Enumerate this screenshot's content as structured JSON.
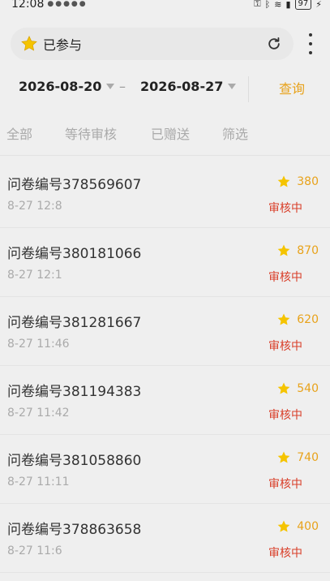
{
  "status_bar": {
    "time": "12:08",
    "battery": "97"
  },
  "header": {
    "title": "已参与"
  },
  "filter": {
    "start_date": "2026-08-20",
    "separator": "–",
    "end_date": "2026-08-27",
    "query_label": "查询"
  },
  "tabs": [
    {
      "label": "全部"
    },
    {
      "label": "等待审核"
    },
    {
      "label": "已赠送"
    },
    {
      "label": "筛选"
    }
  ],
  "items": [
    {
      "title": "问卷编号378569607",
      "time": "8-27 12:8",
      "points": "380",
      "status": "审核中"
    },
    {
      "title": "问卷编号380181066",
      "time": "8-27 12:1",
      "points": "870",
      "status": "审核中"
    },
    {
      "title": "问卷编号381281667",
      "time": "8-27 11:46",
      "points": "620",
      "status": "审核中"
    },
    {
      "title": "问卷编号381194383",
      "time": "8-27 11:42",
      "points": "540",
      "status": "审核中"
    },
    {
      "title": "问卷编号381058860",
      "time": "8-27 11:11",
      "points": "740",
      "status": "审核中"
    },
    {
      "title": "问卷编号378863658",
      "time": "8-27 11:6",
      "points": "400",
      "status": "审核中"
    }
  ],
  "colors": {
    "accent": "#e8a21a",
    "status": "#d9402b",
    "star": "#f5c400"
  }
}
